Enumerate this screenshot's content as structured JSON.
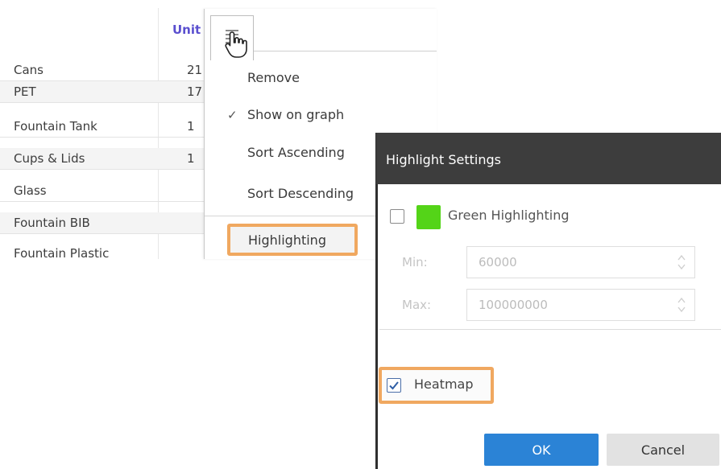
{
  "table": {
    "column_header": "Unit",
    "rows": [
      {
        "name": "Cans",
        "value": "21"
      },
      {
        "name": "PET",
        "value": "17"
      },
      {
        "name": "Fountain Tank",
        "value": "1"
      },
      {
        "name": "Cups & Lids",
        "value": "1"
      },
      {
        "name": "Glass",
        "value": ""
      },
      {
        "name": "Fountain BIB",
        "value": ""
      },
      {
        "name": "Fountain Plastic",
        "value": ""
      }
    ]
  },
  "menu": {
    "items": [
      "Remove",
      "Show on graph",
      "Sort Ascending",
      "Sort Descending",
      "Highlighting"
    ],
    "checked_item": "Show on graph",
    "icon": "menu-lines-icon",
    "cursor": "hand-pointer-icon"
  },
  "dialog": {
    "title": "Highlight Settings",
    "green": {
      "label": "Green Highlighting",
      "checked": false,
      "color": "#54d418"
    },
    "min": {
      "label": "Min:",
      "value": "60000"
    },
    "max": {
      "label": "Max:",
      "value": "100000000"
    },
    "heatmap": {
      "label": "Heatmap",
      "checked": true
    },
    "ok_label": "OK",
    "cancel_label": "Cancel"
  },
  "colors": {
    "highlight_outline": "#f0a860",
    "ok_button": "#2b83d6",
    "header_text": "#5a4fcf",
    "dialog_header": "#3d3d3d"
  }
}
